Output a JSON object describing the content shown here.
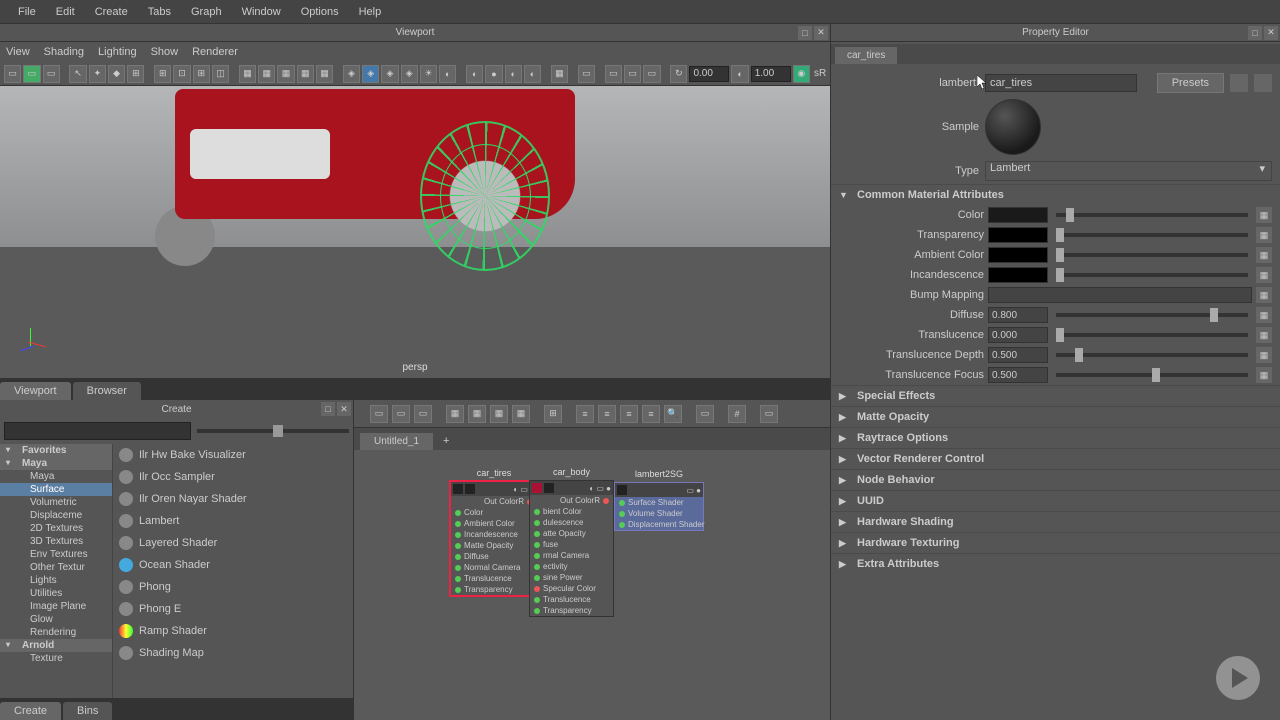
{
  "menubar": [
    "File",
    "Edit",
    "Create",
    "Tabs",
    "Graph",
    "Window",
    "Options",
    "Help"
  ],
  "viewport": {
    "title": "Viewport",
    "menus": [
      "View",
      "Shading",
      "Lighting",
      "Show",
      "Renderer"
    ],
    "camera": "persp",
    "inputs": {
      "a": "0.00",
      "b": "1.00"
    },
    "sR": "sR"
  },
  "bottom_tabs": {
    "viewport": "Viewport",
    "browser": "Browser"
  },
  "create": {
    "title": "Create",
    "tree": {
      "favorites": "Favorites",
      "maya": "Maya",
      "maya_items": [
        "Maya",
        "Surface",
        "Volumetric",
        "Displaceme",
        "2D Textures",
        "3D Textures",
        "Env Textures",
        "Other Textur",
        "Lights",
        "Utilities",
        "Image Plane",
        "Glow",
        "Rendering"
      ],
      "arnold": "Arnold",
      "arnold_items": [
        "Texture"
      ]
    },
    "shaders": [
      "Ilr Hw Bake Visualizer",
      "Ilr Occ Sampler",
      "Ilr Oren Nayar Shader",
      "Lambert",
      "Layered Shader",
      "Ocean Shader",
      "Phong",
      "Phong E",
      "Ramp Shader",
      "Shading Map"
    ],
    "tabs": {
      "create": "Create",
      "bins": "Bins"
    }
  },
  "node_editor": {
    "tab": "Untitled_1",
    "nodes": {
      "car_tires": {
        "label": "car_tires",
        "out": "Out ColorR",
        "attrs": [
          "Color",
          "Ambient Color",
          "Incandescence",
          "Matte Opacity",
          "Diffuse",
          "Normal Camera",
          "Translucence",
          "Transparency"
        ]
      },
      "car_body": {
        "label": "car_body",
        "out": "Out ColorR",
        "attrs": [
          "bient Color",
          "dulescence",
          "atte Opacity",
          "fuse",
          "rmal Camera",
          "ectivity",
          "sine Power",
          "Specular Color",
          "Translucence",
          "Transparency"
        ]
      },
      "lambert2SG": {
        "label": "lambert2SG",
        "attrs": [
          "Surface Shader",
          "Volume Shader",
          "Displacement Shader"
        ]
      }
    }
  },
  "property_editor": {
    "title": "Property Editor",
    "tab": "car_tires",
    "type_label": "lambert:",
    "name": "car_tires",
    "presets": "Presets",
    "sample": "Sample",
    "type": "Type",
    "type_value": "Lambert",
    "section_common": "Common Material Attributes",
    "attrs": {
      "color": "Color",
      "transparency": "Transparency",
      "ambient": "Ambient Color",
      "incandescence": "Incandescence",
      "bump": "Bump Mapping",
      "diffuse": "Diffuse",
      "diffuse_val": "0.800",
      "translucence": "Translucence",
      "translucence_val": "0.000",
      "trans_depth": "Translucence Depth",
      "trans_depth_val": "0.500",
      "trans_focus": "Translucence Focus",
      "trans_focus_val": "0.500"
    },
    "sections": [
      "Special Effects",
      "Matte Opacity",
      "Raytrace Options",
      "Vector Renderer Control",
      "Node Behavior",
      "UUID",
      "Hardware Shading",
      "Hardware Texturing",
      "Extra Attributes"
    ]
  }
}
